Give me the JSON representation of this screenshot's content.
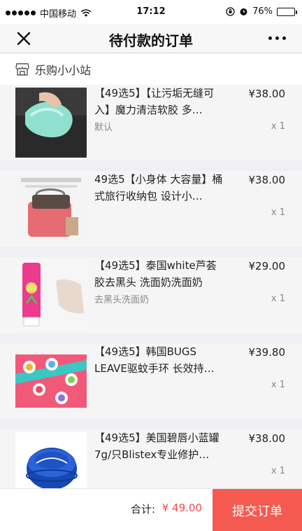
{
  "status": {
    "carrier": "中国移动",
    "time": "17:12",
    "battery": "76%",
    "battery_level": 0.76
  },
  "nav": {
    "title": "待付款的订单"
  },
  "shop": {
    "name": "乐购小小站"
  },
  "items": [
    {
      "title": "【49选5】【让污垢无缝可入】魔力清洁软胶 多…",
      "spec": "默认",
      "price": "¥38.00",
      "qty": "x 1"
    },
    {
      "title": "49选5【小身体 大容量】桶式旅行收纳包 设计小…",
      "spec": "",
      "price": "¥38.00",
      "qty": "x 1"
    },
    {
      "title": "【49选5】泰国white芦荟胶去黑头 洗面奶洗面奶",
      "spec": "去黑头洗面奶",
      "price": "¥29.00",
      "qty": "x 1"
    },
    {
      "title": "【49选5】韩国BUGS LEAVE驱蚊手环 长效持久3…",
      "spec": "",
      "price": "¥39.80",
      "qty": "x 1"
    },
    {
      "title": "【49选5】美国碧唇小蓝罐7g/只Blistex专业修护…",
      "spec": "",
      "price": "¥38.00",
      "qty": "x 1"
    }
  ],
  "footer": {
    "total_label": "合计:",
    "total_value": "¥ 49.00",
    "submit_label": "提交订单"
  },
  "colors": {
    "accent": "#f55a50",
    "price_red": "#f04b4b"
  }
}
